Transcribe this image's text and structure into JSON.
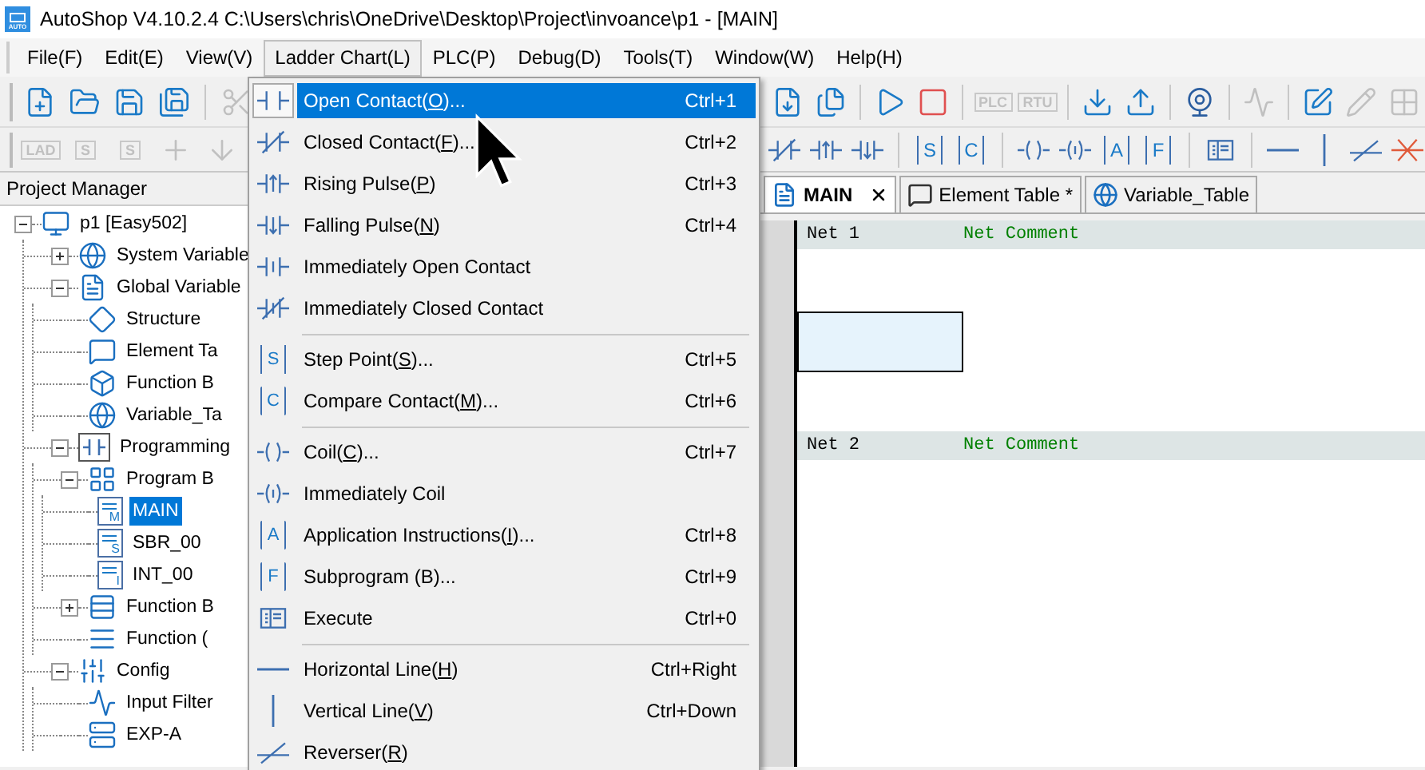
{
  "window": {
    "app_icon_text": "AUTO",
    "title": "AutoShop V4.10.2.4  C:\\Users\\chris\\OneDrive\\Desktop\\Project\\invoance\\p1 - [MAIN]"
  },
  "menu_bar": [
    {
      "label": "File(F)",
      "selected": false
    },
    {
      "label": "Edit(E)",
      "selected": false
    },
    {
      "label": "View(V)",
      "selected": false
    },
    {
      "label": "Ladder Chart(L)",
      "selected": true
    },
    {
      "label": "PLC(P)",
      "selected": false
    },
    {
      "label": "Debug(D)",
      "selected": false
    },
    {
      "label": "Tools(T)",
      "selected": false
    },
    {
      "label": "Window(W)",
      "selected": false
    },
    {
      "label": "Help(H)",
      "selected": false
    }
  ],
  "toolbar_1": {
    "left": [
      {
        "disabled": false
      },
      {
        "disabled": false
      },
      {
        "disabled": false
      },
      {
        "disabled": false
      },
      {
        "disabled": true
      }
    ],
    "right": [
      {
        "disabled": false
      },
      {
        "disabled": false
      },
      {
        "disabled": false
      },
      {
        "disabled": false
      },
      {
        "text": "PLC",
        "disabled": true
      },
      {
        "text": "RTU",
        "disabled": true
      },
      {
        "disabled": false
      },
      {
        "disabled": false
      },
      {
        "disabled": false
      },
      {
        "disabled": true
      },
      {
        "disabled": false
      },
      {
        "disabled": true
      },
      {
        "disabled": true
      }
    ]
  },
  "toolbar_2": {
    "left": [
      {
        "text": "LAD",
        "disabled": true
      },
      {
        "text": "S",
        "disabled": true
      },
      {
        "text": "S",
        "disabled": true
      },
      {
        "disabled": true
      },
      {
        "disabled": true
      }
    ],
    "right": [
      {
        "disabled": false
      },
      {
        "disabled": false
      },
      {
        "disabled": false
      },
      {
        "text": "S",
        "disabled": false
      },
      {
        "text": "C",
        "disabled": false
      },
      {
        "disabled": false
      },
      {
        "disabled": false
      },
      {
        "text": "A",
        "disabled": false
      },
      {
        "text": "F",
        "disabled": false
      },
      {
        "disabled": false
      },
      {
        "disabled": false
      },
      {
        "disabled": false
      },
      {
        "disabled": false
      },
      {
        "disabled": false
      }
    ]
  },
  "project_manager": {
    "title": "Project Manager",
    "tree": [
      {
        "label": "p1 [Easy502]",
        "selected": false,
        "expanded": true,
        "children": [
          {
            "label": "System Variable",
            "selected": false,
            "expanded": false
          },
          {
            "label": "Global Variable",
            "selected": false,
            "expanded": true,
            "children": [
              {
                "label": "Structure",
                "selected": false
              },
              {
                "label": "Element Ta",
                "selected": false
              },
              {
                "label": "Function B",
                "selected": false
              },
              {
                "label": "Variable_Ta",
                "selected": false
              }
            ]
          },
          {
            "label": "Programming",
            "selected": false,
            "expanded": true,
            "children": [
              {
                "label": "Program B",
                "selected": false,
                "expanded": true,
                "children": [
                  {
                    "label": "MAIN",
                    "icon_text": "M",
                    "selected": true
                  },
                  {
                    "label": "SBR_00",
                    "icon_text": "S",
                    "selected": false
                  },
                  {
                    "label": "INT_00",
                    "icon_text": "I",
                    "selected": false
                  }
                ]
              },
              {
                "label": "Function B",
                "selected": false,
                "expanded": false
              },
              {
                "label": "Function (",
                "selected": false
              }
            ]
          },
          {
            "label": "Config",
            "selected": false,
            "expanded": true,
            "children": [
              {
                "label": "Input Filter",
                "selected": false
              },
              {
                "label": "EXP-A",
                "selected": false
              }
            ]
          }
        ]
      }
    ]
  },
  "editor": {
    "tabs": [
      {
        "label": "MAIN",
        "selected": true,
        "closable": true
      },
      {
        "label": "Element Table *",
        "selected": false,
        "closable": false
      },
      {
        "label": "Variable_Table",
        "selected": false,
        "closable": false
      }
    ],
    "networks": [
      {
        "label": "Net 1",
        "comment": "Net Comment",
        "cell_selected": true
      },
      {
        "label": "Net 2",
        "comment": "Net Comment",
        "cell_selected": false
      }
    ]
  },
  "dropdown_menu": {
    "items": [
      {
        "kind": "item",
        "label": "Open Contact(",
        "mnemonic": "O",
        "label_end": ")...",
        "shortcut": "Ctrl+1",
        "selected": true
      },
      {
        "kind": "item",
        "label": "Closed Contact(",
        "mnemonic": "F",
        "label_end": ")...",
        "shortcut": "Ctrl+2",
        "selected": false
      },
      {
        "kind": "item",
        "label": "Rising Pulse(",
        "mnemonic": "P",
        "label_end": ")",
        "shortcut": "Ctrl+3",
        "selected": false
      },
      {
        "kind": "item",
        "label": "Falling Pulse(",
        "mnemonic": "N",
        "label_end": ")",
        "shortcut": "Ctrl+4",
        "selected": false
      },
      {
        "kind": "item",
        "label": "Immediately Open Contact",
        "selected": false
      },
      {
        "kind": "item",
        "label": "Immediately Closed Contact",
        "selected": false
      },
      {
        "kind": "separator"
      },
      {
        "kind": "item",
        "label": "Step Point(",
        "mnemonic": "S",
        "label_end": ")...",
        "shortcut": "Ctrl+5",
        "icon_text": "S",
        "selected": false
      },
      {
        "kind": "item",
        "label": "Compare Contact(",
        "mnemonic": "M",
        "label_end": ")...",
        "shortcut": "Ctrl+6",
        "icon_text": "C",
        "selected": false
      },
      {
        "kind": "separator"
      },
      {
        "kind": "item",
        "label": "Coil(",
        "mnemonic": "C",
        "label_end": ")...",
        "shortcut": "Ctrl+7",
        "selected": false
      },
      {
        "kind": "item",
        "label": "Immediately Coil",
        "selected": false
      },
      {
        "kind": "item",
        "label": "Application Instructions(",
        "mnemonic": "I",
        "label_end": ")...",
        "shortcut": "Ctrl+8",
        "icon_text": "A",
        "selected": false
      },
      {
        "kind": "item",
        "label": "Subprogram (B)...",
        "shortcut": "Ctrl+9",
        "icon_text": "F",
        "selected": false
      },
      {
        "kind": "item",
        "label": "Execute",
        "shortcut": "Ctrl+0",
        "selected": false
      },
      {
        "kind": "separator"
      },
      {
        "kind": "item",
        "label": "Horizontal Line(",
        "mnemonic": "H",
        "label_end": ")",
        "shortcut": "Ctrl+Right",
        "selected": false
      },
      {
        "kind": "item",
        "label": "Vertical Line(",
        "mnemonic": "V",
        "label_end": ")",
        "shortcut": "Ctrl+Down",
        "selected": false
      },
      {
        "kind": "item",
        "label": "Reverser(",
        "mnemonic": "R",
        "label_end": ")",
        "selected": false
      }
    ]
  }
}
